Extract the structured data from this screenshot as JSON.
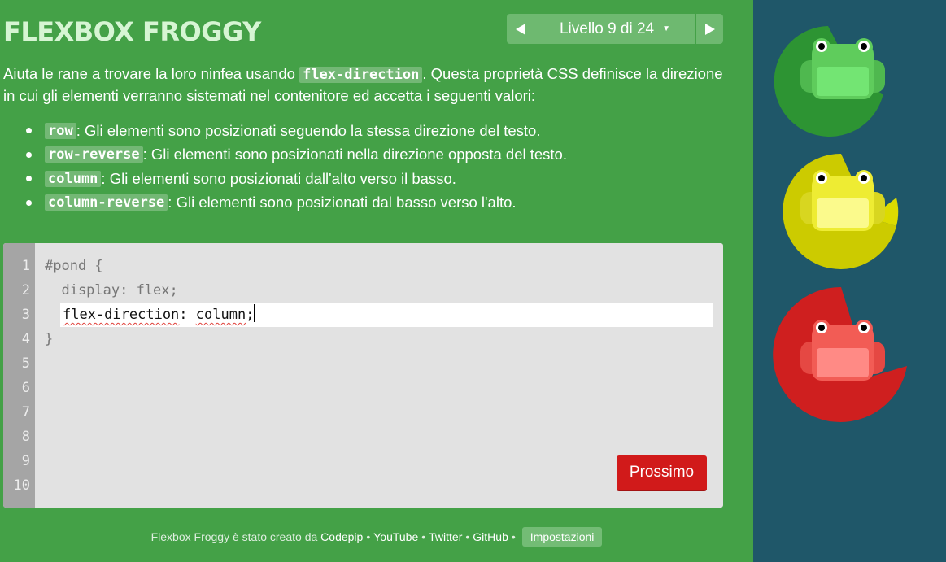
{
  "header": {
    "title": "FLEXBOX FROGGY",
    "level_label": "Livello 9 di 24"
  },
  "instructions": {
    "intro_before": "Aiuta le rane a trovare la loro ninfea usando ",
    "intro_code": "flex-direction",
    "intro_after": ". Questa proprietà CSS definisce la direzione in cui gli elementi verranno sistemati nel contenitore ed accetta i seguenti valori:",
    "values": [
      {
        "code": "row",
        "text": ": Gli elementi sono posizionati seguendo la stessa direzione del testo."
      },
      {
        "code": "row-reverse",
        "text": ": Gli elementi sono posizionati nella direzione opposta del testo."
      },
      {
        "code": "column",
        "text": ": Gli elementi sono posizionati dall'alto verso il basso."
      },
      {
        "code": "column-reverse",
        "text": ": Gli elementi sono posizionati dal basso verso l'alto."
      }
    ]
  },
  "editor": {
    "line_numbers": [
      "1",
      "2",
      "3",
      "4",
      "5",
      "6",
      "7",
      "8",
      "9",
      "10"
    ],
    "line1": "#pond {",
    "line2": "  display: flex;",
    "input_property": "flex-direction",
    "input_colon": ": ",
    "input_value": "column",
    "input_semicolon": ";",
    "line4": "}",
    "next_button": "Prossimo"
  },
  "footer": {
    "credit": "Flexbox Froggy è stato creato da",
    "links": [
      "Codepip",
      "YouTube",
      "Twitter",
      "GitHub"
    ],
    "separator": "•",
    "settings": "Impostazioni"
  },
  "board": {
    "frogs": [
      "green",
      "yellow",
      "red"
    ],
    "colors": {
      "green_pad": "#2d9433",
      "green_frog": "#5fcc5c",
      "yellow_pad": "#cccb00",
      "yellow_frog": "#eeec33",
      "red_pad": "#cf1f1f",
      "red_frog": "#f25c55"
    }
  }
}
